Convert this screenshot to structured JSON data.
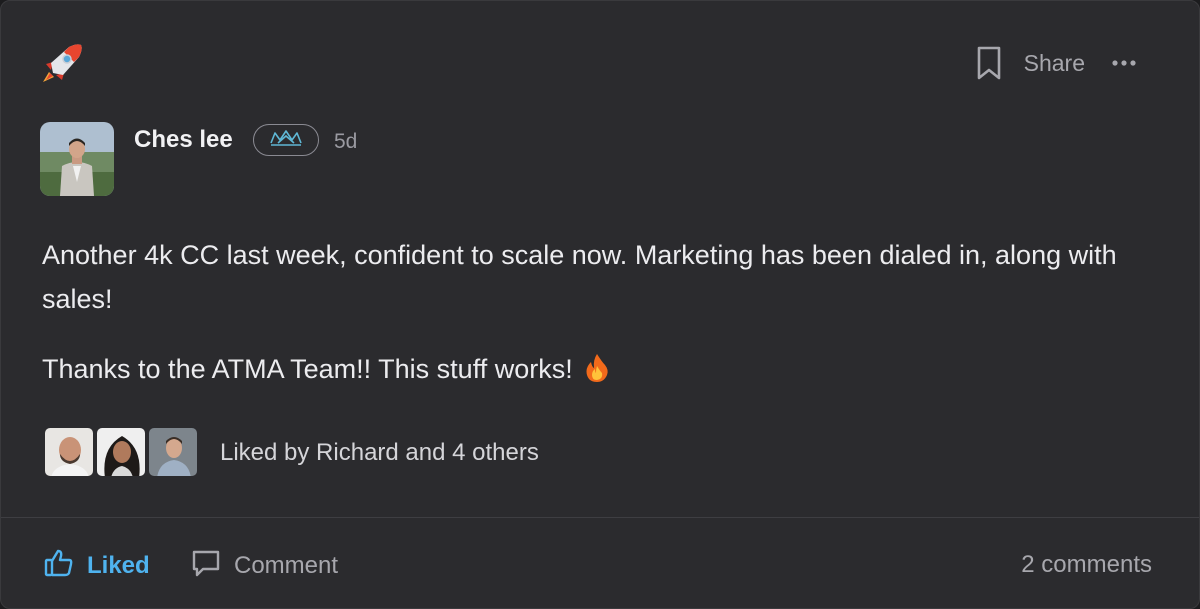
{
  "post": {
    "author": "Ches lee",
    "time_ago": "5d",
    "paragraphs": [
      "Another 4k CC last week, confident to scale now. Marketing has been dialed in, along with sales!",
      "Thanks to the ATMA Team!! This stuff works!"
    ]
  },
  "header": {
    "share_label": "Share",
    "icons": [
      "rocket-icon",
      "bookmark-icon",
      "more-icon"
    ]
  },
  "badge": {
    "icon": "crown-icon"
  },
  "likes": {
    "text": "Liked by Richard and 4 others"
  },
  "footer": {
    "liked_label": "Liked",
    "comment_label": "Comment",
    "comments_count": "2 comments"
  },
  "colors": {
    "card_bg": "#2b2b2e",
    "accent_blue": "#4fb3ef",
    "badge_teal": "#5fb8d6"
  }
}
